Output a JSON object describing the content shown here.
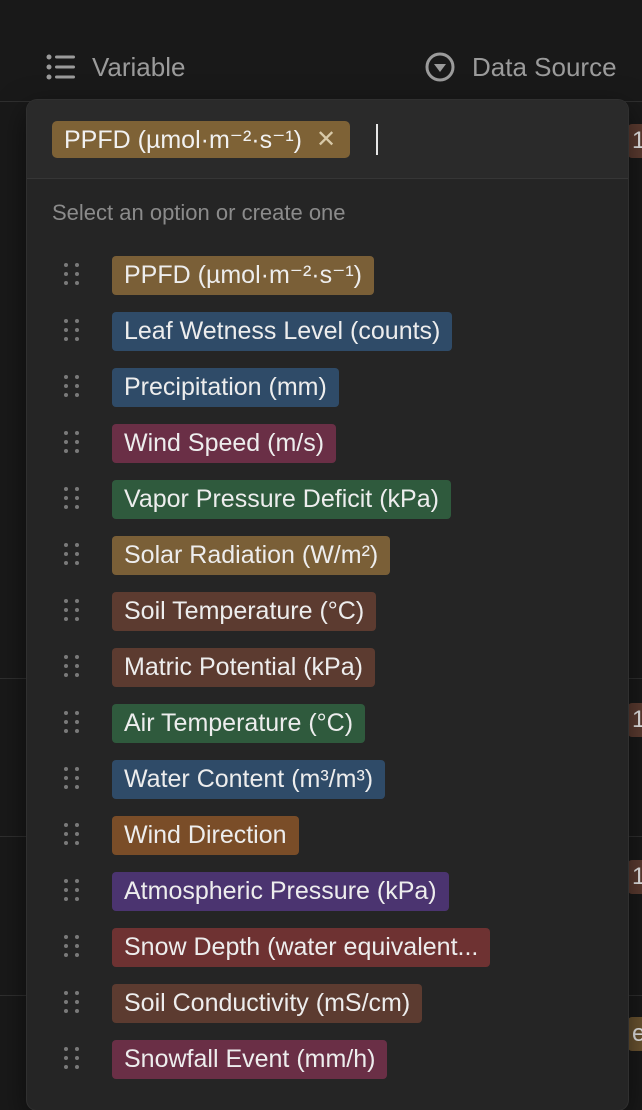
{
  "header": {
    "variable_label": "Variable",
    "source_label": "Data Source"
  },
  "right_stubs": [
    {
      "text": "1",
      "color": "#5c3b30"
    },
    {
      "text": "1",
      "color": "#5c3b30"
    },
    {
      "text": "1",
      "color": "#5c3b30"
    },
    {
      "text": "e",
      "color": "#6b5430"
    }
  ],
  "selected": {
    "label": "PPFD (µmol·m⁻²·s⁻¹)",
    "color": "#7e6236",
    "remove_label": "✕"
  },
  "hint": "Select an option or create one",
  "options": [
    {
      "label": "PPFD (µmol·m⁻²·s⁻¹)",
      "color": "#7a5f37"
    },
    {
      "label": "Leaf Wetness Level (counts)",
      "color": "#2f4b68"
    },
    {
      "label": "Precipitation (mm)",
      "color": "#2f4b68"
    },
    {
      "label": "Wind Speed (m/s)",
      "color": "#6a2f46"
    },
    {
      "label": "Vapor Pressure Deficit (kPa)",
      "color": "#2f5a3d"
    },
    {
      "label": "Solar Radiation (W/m²)",
      "color": "#7a5f37"
    },
    {
      "label": "Soil Temperature (°C)",
      "color": "#5c3b30"
    },
    {
      "label": "Matric Potential (kPa)",
      "color": "#5c3b30"
    },
    {
      "label": "Air Temperature (°C)",
      "color": "#2f5a3d"
    },
    {
      "label": "Water Content (m³/m³)",
      "color": "#2f4b68"
    },
    {
      "label": "Wind Direction",
      "color": "#7a4d28"
    },
    {
      "label": "Atmospheric Pressure (kPa)",
      "color": "#4b3470"
    },
    {
      "label": "Snow Depth (water equivalent...",
      "color": "#6e3232"
    },
    {
      "label": "Soil Conductivity (mS/cm)",
      "color": "#5c3b30"
    },
    {
      "label": "Snowfall Event (mm/h)",
      "color": "#6a2f46"
    }
  ]
}
